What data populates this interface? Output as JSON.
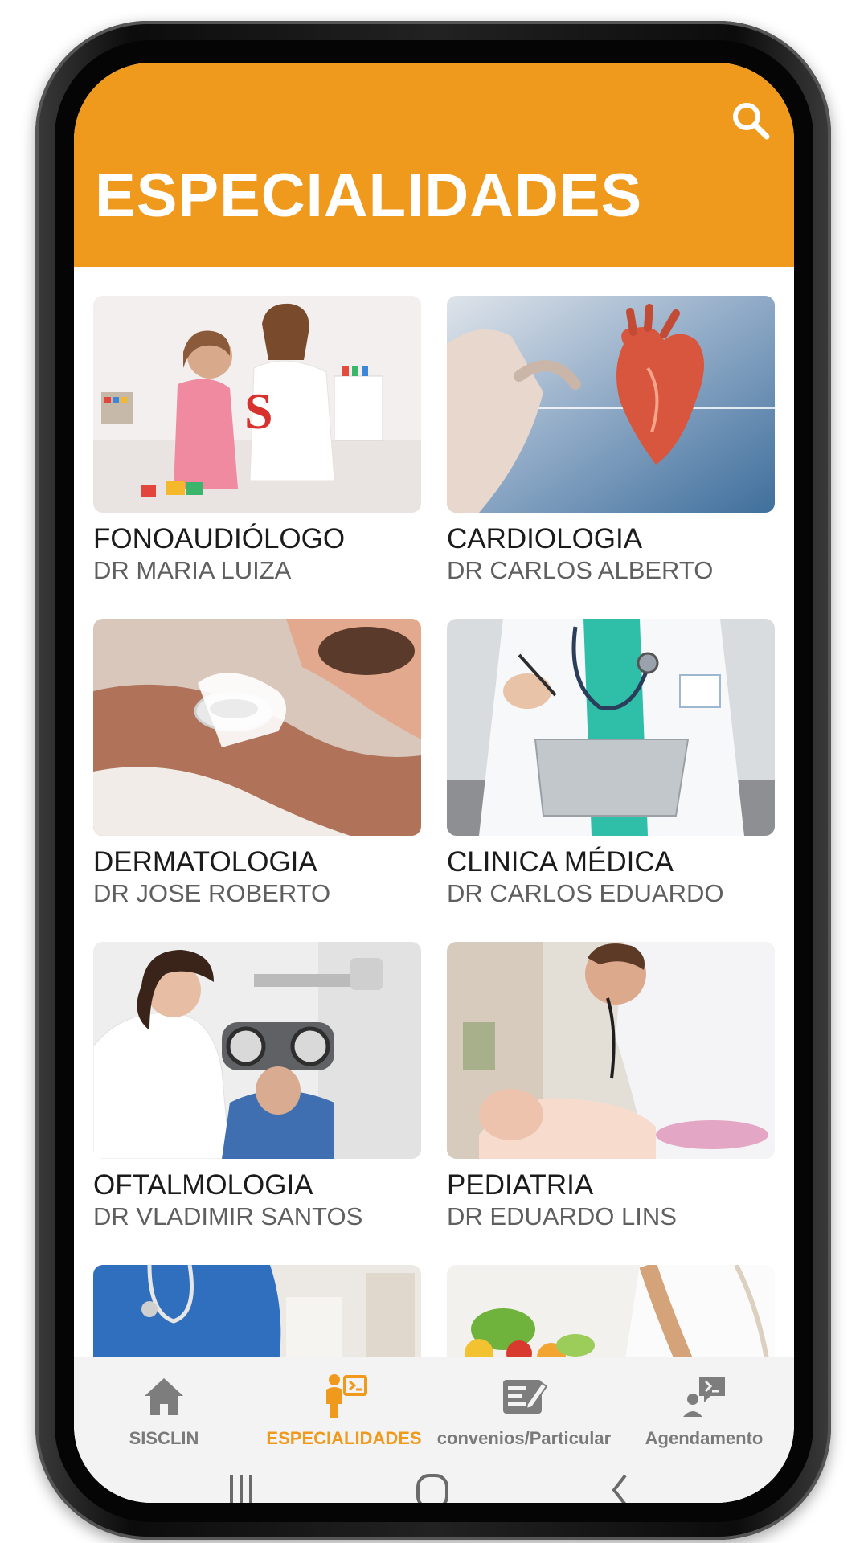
{
  "header": {
    "title": "ESPECIALIDADES",
    "background_color": "#f09a1d",
    "search_icon": "search-icon"
  },
  "specialties": [
    {
      "title": "FONOAUDIÓLOGO",
      "doctor": "DR MARIA LUIZA",
      "image": "speech-therapy-photo"
    },
    {
      "title": "CARDIOLOGIA",
      "doctor": "DR CARLOS ALBERTO",
      "image": "heart-photo"
    },
    {
      "title": "DERMATOLOGIA",
      "doctor": "DR JOSE ROBERTO",
      "image": "dermatoscope-photo"
    },
    {
      "title": "CLINICA MÉDICA",
      "doctor": "DR CARLOS EDUARDO",
      "image": "doctor-clipboard-photo"
    },
    {
      "title": "OFTALMOLOGIA",
      "doctor": "DR VLADIMIR SANTOS",
      "image": "eye-exam-photo"
    },
    {
      "title": "PEDIATRIA",
      "doctor": "DR EDUARDO LINS",
      "image": "pediatrician-baby-photo"
    },
    {
      "title": "",
      "doctor": "",
      "image": "nurse-photo"
    },
    {
      "title": "",
      "doctor": "",
      "image": "nutrition-photo"
    }
  ],
  "bottom_nav": {
    "items": [
      {
        "label": "SISCLIN",
        "icon": "home-icon",
        "active": false
      },
      {
        "label": "ESPECIALIDADES",
        "icon": "specialist-icon",
        "active": true
      },
      {
        "label": "convenios/Particular",
        "icon": "edit-document-icon",
        "active": false
      },
      {
        "label": "Agendamento",
        "icon": "chat-person-icon",
        "active": false
      }
    ],
    "active_color": "#f09a1d",
    "inactive_color": "#7a7a7a"
  },
  "system_nav": {
    "buttons": [
      "recent-apps-icon",
      "home-button-icon",
      "back-icon"
    ]
  }
}
